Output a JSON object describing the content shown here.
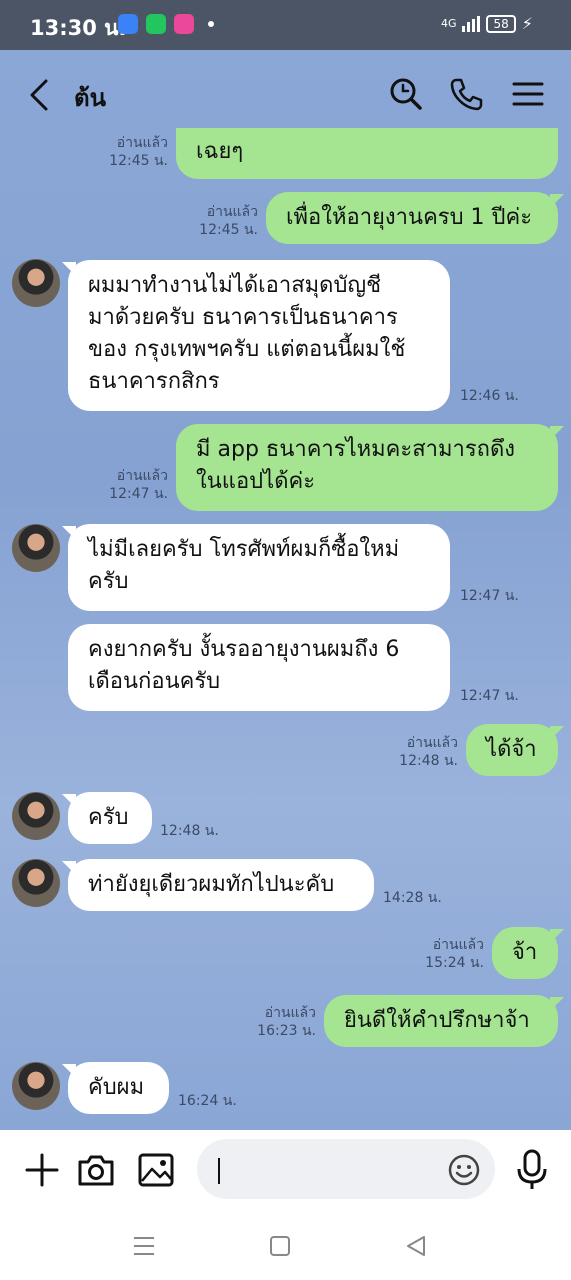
{
  "status": {
    "time": "13:30 น.",
    "network": "4G",
    "battery": "58"
  },
  "header": {
    "title": "ต้น"
  },
  "messages": [
    {
      "side": "me",
      "text": "เฉยๆ",
      "read": "อ่านแล้ว",
      "time": "12:45 น."
    },
    {
      "side": "me",
      "text": "เพื่อให้อายุงานครบ 1 ปีค่ะ",
      "read": "อ่านแล้ว",
      "time": "12:45 น."
    },
    {
      "side": "them",
      "lines": [
        "ผมมาทำงานไม่ได้เอาสมุดบัญชี",
        "มาด้วยครับ ธนาคารเป็นธนาคาร",
        "ของ กรุงเทพฯครับ แต่ตอนนี้ผมใช้",
        "ธนาคารกสิกร"
      ],
      "time": "12:46 น."
    },
    {
      "side": "me",
      "lines": [
        "มี app ธนาคารไหมคะสามารถดึง",
        "ในแอปได้ค่ะ"
      ],
      "read": "อ่านแล้ว",
      "time": "12:47 น."
    },
    {
      "side": "them",
      "lines": [
        "ไม่มีเลยครับ โทรศัพท์ผมก็ซื้อใหม่",
        "ครับ"
      ],
      "time": "12:47 น."
    },
    {
      "side": "them",
      "lines": [
        "คงยากครับ งั้นรออายุงานผมถึง 6",
        "เดือนก่อนครับ"
      ],
      "time": "12:47 น."
    },
    {
      "side": "me",
      "text": "ได้จ้า",
      "read": "อ่านแล้ว",
      "time": "12:48 น."
    },
    {
      "side": "them",
      "text": "ครับ",
      "time": "12:48 น."
    },
    {
      "side": "them",
      "text": "ท่ายังยุเดียวผมทักไปนะคับ",
      "time": "14:28 น."
    },
    {
      "side": "me",
      "text": "จ้า",
      "read": "อ่านแล้ว",
      "time": "15:24 น."
    },
    {
      "side": "me",
      "text": "ยินดีให้คำปรึกษาจ้า",
      "read": "อ่านแล้ว",
      "time": "16:23 น."
    },
    {
      "side": "them",
      "text": "คับผม",
      "time": "16:24 น."
    }
  ],
  "input": {
    "placeholder": ""
  },
  "colors": {
    "chat_bg": "#8aa7d6",
    "my_bubble": "#a5e591",
    "their_bubble": "#ffffff",
    "status_bar": "#4c5566"
  }
}
